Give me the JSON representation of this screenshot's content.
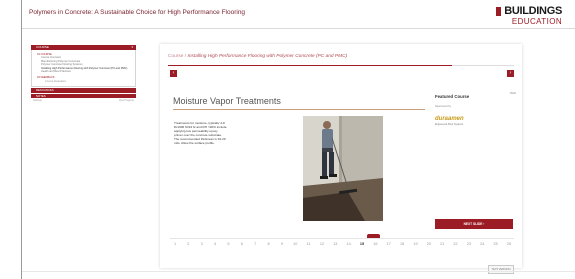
{
  "header": {
    "course_heading": "Polymers in Concrete: A Sustainable Choice for High Performance Flooring",
    "logo_top": "BUILDINGS",
    "logo_bottom": "EDUCATION"
  },
  "sidebar": {
    "sections": [
      {
        "label": "COURSE",
        "expanded": true,
        "body_label": "01 COURSE",
        "items": [
          {
            "label": "Course Overview",
            "active": false
          },
          {
            "label": "Manufacturing Polymer Concretes",
            "active": false
          },
          {
            "label": "Polymer Concrete Flooring Systems",
            "active": false
          },
          {
            "label": "Installing High Performance Flooring with Polymer Concrete (PC and PMC)",
            "active": true
          },
          {
            "label": "Health and Best Practices",
            "active": false
          }
        ],
        "subsection_label": "02 FEEDBACK",
        "sub_items": [
          "Course Evaluation"
        ]
      },
      {
        "label": "RESOURCES",
        "expanded": false
      },
      {
        "label": "NOTES",
        "expanded": false
      }
    ],
    "footer_left": "Settings",
    "footer_right": "Quiz Progress"
  },
  "course": {
    "prefix": "Course /",
    "title": "Installing High Performance Flooring with Polymer Concrete (PC and PMC)",
    "progress": 0.82,
    "prev_glyph": "‹",
    "next_glyph": "›"
  },
  "slide": {
    "title": "Moisture Vapor Treatments",
    "body": "Treatments for moisture, typically 4-8 lb/1000 ft²/24 hr and RH >90% include applying low permeability epoxy primer over the concrete substrate. The recommended thickness is 16-20 mils. Allow the surface profile.",
    "photo_alt": "worker applying coating to concrete floor"
  },
  "featured": {
    "title": "Featured Course",
    "subtitle": "Sponsored by",
    "logo_text": "duraamen",
    "logo_tagline": "Engineered Floor Systems",
    "counter": "15/26",
    "next_slide_label": "NEXT SLIDE  ›"
  },
  "pager": {
    "pages": [
      "1",
      "2",
      "3",
      "4",
      "5",
      "6",
      "7",
      "8",
      "9",
      "10",
      "11",
      "12",
      "13",
      "14",
      "15",
      "16",
      "17",
      "18",
      "19",
      "20",
      "21",
      "22",
      "23",
      "24",
      "25",
      "26"
    ],
    "current": "15"
  },
  "text_only_label": "TEXT VERSION"
}
